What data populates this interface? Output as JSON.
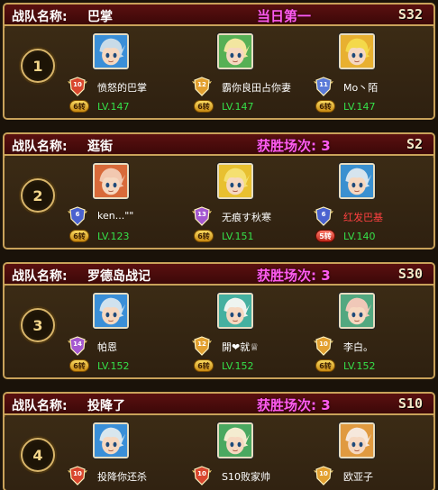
{
  "team_label": "战队名称:",
  "teams": [
    {
      "rank": "1",
      "name": "巴掌",
      "result": "当日第一",
      "server": "S32",
      "members": [
        {
          "name": "愤怒的巴掌",
          "badge": "10",
          "badge_color": "#d8462e",
          "turn": "6转",
          "level": "LV.147",
          "avatar_hair": "#c8dbe8",
          "avatar_bg": "#3a8fd8",
          "name_color": "white"
        },
        {
          "name": "霸你良田占你妻",
          "badge": "12",
          "badge_color": "#e2a030",
          "turn": "6转",
          "level": "LV.147",
          "avatar_hair": "#f2e6a0",
          "avatar_bg": "#56b055",
          "name_color": "white"
        },
        {
          "name": "Mo丶陌",
          "badge": "11",
          "badge_color": "#5a7ad8",
          "turn": "6转",
          "level": "LV.147",
          "avatar_hair": "#f4d94a",
          "avatar_bg": "#e8b030",
          "name_color": "white"
        }
      ]
    },
    {
      "rank": "2",
      "name": "逛街",
      "result": "获胜场次: 3",
      "server": "S2",
      "members": [
        {
          "name": "ken...\"\"",
          "badge": "6",
          "badge_color": "#4a62d0",
          "turn": "6转",
          "level": "LV.123",
          "avatar_hair": "#f2c8b0",
          "avatar_bg": "#d86a3a",
          "name_color": "white"
        },
        {
          "name": "无痕す秋寒",
          "badge": "13",
          "badge_color": "#a458d0",
          "turn": "6转",
          "level": "LV.151",
          "avatar_hair": "#f5e070",
          "avatar_bg": "#e8c030",
          "name_color": "white"
        },
        {
          "name": "红发巴基",
          "badge": "6",
          "badge_color": "#4a62d0",
          "turn": "5转",
          "level": "LV.140",
          "avatar_hair": "#d6e4ee",
          "avatar_bg": "#3a90d0",
          "name_color": "red",
          "turn_color": "red"
        }
      ]
    },
    {
      "rank": "3",
      "name": "罗德岛战记",
      "result": "获胜场次: 3",
      "server": "S30",
      "members": [
        {
          "name": "帕恩",
          "badge": "14",
          "badge_color": "#a458d0",
          "turn": "6转",
          "level": "LV.152",
          "avatar_hair": "#d0e2ee",
          "avatar_bg": "#3a8fd8",
          "name_color": "white"
        },
        {
          "name": "開❤就♕",
          "badge": "12",
          "badge_color": "#e2a030",
          "turn": "6转",
          "level": "LV.152",
          "avatar_hair": "#eef4f0",
          "avatar_bg": "#45b0a0",
          "name_color": "white"
        },
        {
          "name": "李白。",
          "badge": "10",
          "badge_color": "#e2a030",
          "turn": "6转",
          "level": "LV.152",
          "avatar_hair": "#f0c8b8",
          "avatar_bg": "#52a880",
          "name_color": "white"
        }
      ]
    },
    {
      "rank": "4",
      "name": "投降了",
      "result": "获胜场次: 3",
      "server": "S10",
      "members": [
        {
          "name": "投降你还杀",
          "badge": "10",
          "badge_color": "#d8462e",
          "turn": "",
          "level": "",
          "avatar_hair": "#d8e6ee",
          "avatar_bg": "#3a8fd8",
          "name_color": "white"
        },
        {
          "name": "S10败家帅",
          "badge": "10",
          "badge_color": "#d8462e",
          "turn": "",
          "level": "",
          "avatar_hair": "#f4ecd0",
          "avatar_bg": "#4aa860",
          "name_color": "white"
        },
        {
          "name": "欧亚子",
          "badge": "10",
          "badge_color": "#e2a030",
          "turn": "",
          "level": "",
          "avatar_hair": "#f6e8dc",
          "avatar_bg": "#e09a40",
          "name_color": "white"
        }
      ]
    }
  ]
}
